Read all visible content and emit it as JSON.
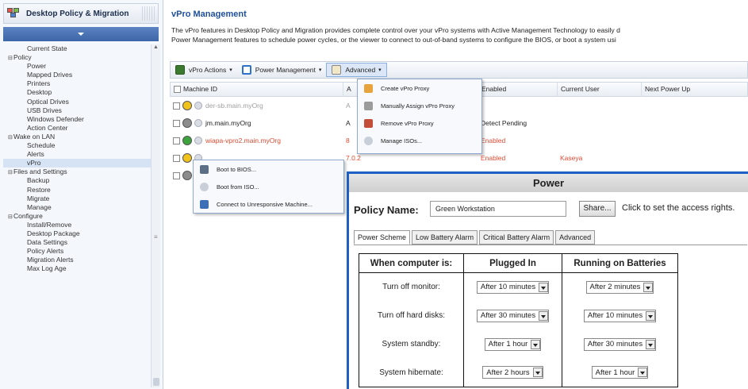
{
  "app": {
    "title": "Desktop Policy & Migration"
  },
  "sidebar": {
    "tree": [
      {
        "label": "Current State",
        "level": 1
      },
      {
        "label": "Policy",
        "level": 0
      },
      {
        "label": "Power",
        "level": 1
      },
      {
        "label": "Mapped Drives",
        "level": 1
      },
      {
        "label": "Printers",
        "level": 1
      },
      {
        "label": "Desktop",
        "level": 1
      },
      {
        "label": "Optical Drives",
        "level": 1
      },
      {
        "label": "USB Drives",
        "level": 1
      },
      {
        "label": "Windows Defender",
        "level": 1
      },
      {
        "label": "Action Center",
        "level": 1
      },
      {
        "label": "Wake on LAN",
        "level": 0
      },
      {
        "label": "Schedule",
        "level": 1
      },
      {
        "label": "Alerts",
        "level": 1
      },
      {
        "label": "vPro",
        "level": 1,
        "selected": true
      },
      {
        "label": "Files and Settings",
        "level": 0
      },
      {
        "label": "Backup",
        "level": 1
      },
      {
        "label": "Restore",
        "level": 1
      },
      {
        "label": "Migrate",
        "level": 1
      },
      {
        "label": "Manage",
        "level": 1
      },
      {
        "label": "Configure",
        "level": 0
      },
      {
        "label": "Install/Remove",
        "level": 1
      },
      {
        "label": "Desktop Package",
        "level": 1
      },
      {
        "label": "Data Settings",
        "level": 1
      },
      {
        "label": "Policy Alerts",
        "level": 1
      },
      {
        "label": "Migration Alerts",
        "level": 1
      },
      {
        "label": "Max Log Age",
        "level": 1
      }
    ]
  },
  "main": {
    "heading": "vPro Management",
    "desc_line1": "The vPro features in Desktop Policy and Migration provides complete control over your vPro systems with Active Management Technology to easily d",
    "desc_line2": "Power Management features to schedule power cycles, or the viewer to connect to out-of-band systems to configure the BIOS, or boot a system usi"
  },
  "toolbar": {
    "vpro_actions": "vPro Actions",
    "power_management": "Power Management",
    "advanced": "Advanced"
  },
  "grid": {
    "columns": [
      "Machine ID",
      "A",
      "Enabled",
      "Current User",
      "Next Power Up"
    ],
    "rows": [
      {
        "machine": "der-sb.main.myOrg",
        "col2": "A",
        "enabled": "",
        "user": "",
        "status": "yellow",
        "style": "faded"
      },
      {
        "machine": "jm.main.myOrg",
        "col2": "A",
        "enabled": "Detect Pending",
        "user": "",
        "status": "gray",
        "style": "normal"
      },
      {
        "machine": "wiapa-vpro2.main.myOrg",
        "col2": "8",
        "enabled": "Enabled",
        "user": "",
        "status": "green",
        "style": "red"
      },
      {
        "machine": "",
        "col2": "7.0.2",
        "enabled": "Enabled",
        "user": "Kaseya",
        "status": "yellow",
        "style": "red"
      },
      {
        "machine": "",
        "col2": "",
        "enabled": "",
        "user": "",
        "status": "gray",
        "style": "normal"
      }
    ]
  },
  "advanced_menu": {
    "items": [
      {
        "label": "Create vPro Proxy",
        "icon": "proxy-icon"
      },
      {
        "label": "Manually Assign vPro Proxy",
        "icon": "assign-icon"
      },
      {
        "label": "Remove vPro Proxy",
        "icon": "remove-icon"
      },
      {
        "label": "Manage ISOs...",
        "icon": "disc-icon"
      }
    ]
  },
  "context_menu": {
    "items": [
      {
        "label": "Boot to BIOS...",
        "icon": "bios-icon"
      },
      {
        "label": "Boot from ISO...",
        "icon": "disc-icon"
      },
      {
        "label": "Connect to Unresponsive Machine...",
        "icon": "monitor-icon"
      }
    ]
  },
  "power_dialog": {
    "title": "Power",
    "policy_label": "Policy Name:",
    "policy_value": "Green Workstation",
    "share_button": "Share...",
    "share_text": "Click to set the access rights.",
    "tabs": [
      "Power Scheme",
      "Low Battery Alarm",
      "Critical Battery Alarm",
      "Advanced"
    ],
    "active_tab": 0,
    "table_headers": [
      "When computer is:",
      "Plugged In",
      "Running on Batteries"
    ],
    "rows": [
      {
        "label": "Turn off monitor:",
        "plugged": "After 10 minutes",
        "battery": "After 2 minutes"
      },
      {
        "label": "Turn off hard disks:",
        "plugged": "After 30 minutes",
        "battery": "After 10 minutes"
      },
      {
        "label": "System standby:",
        "plugged": "After 1 hour",
        "battery": "After 30 minutes"
      },
      {
        "label": "System hibernate:",
        "plugged": "After 2 hours",
        "battery": "After 1 hour"
      }
    ]
  },
  "colors": {
    "accent": "#1f4f9c",
    "dialog_border": "#1e5fc4",
    "enabled_red": "#e24a32"
  }
}
